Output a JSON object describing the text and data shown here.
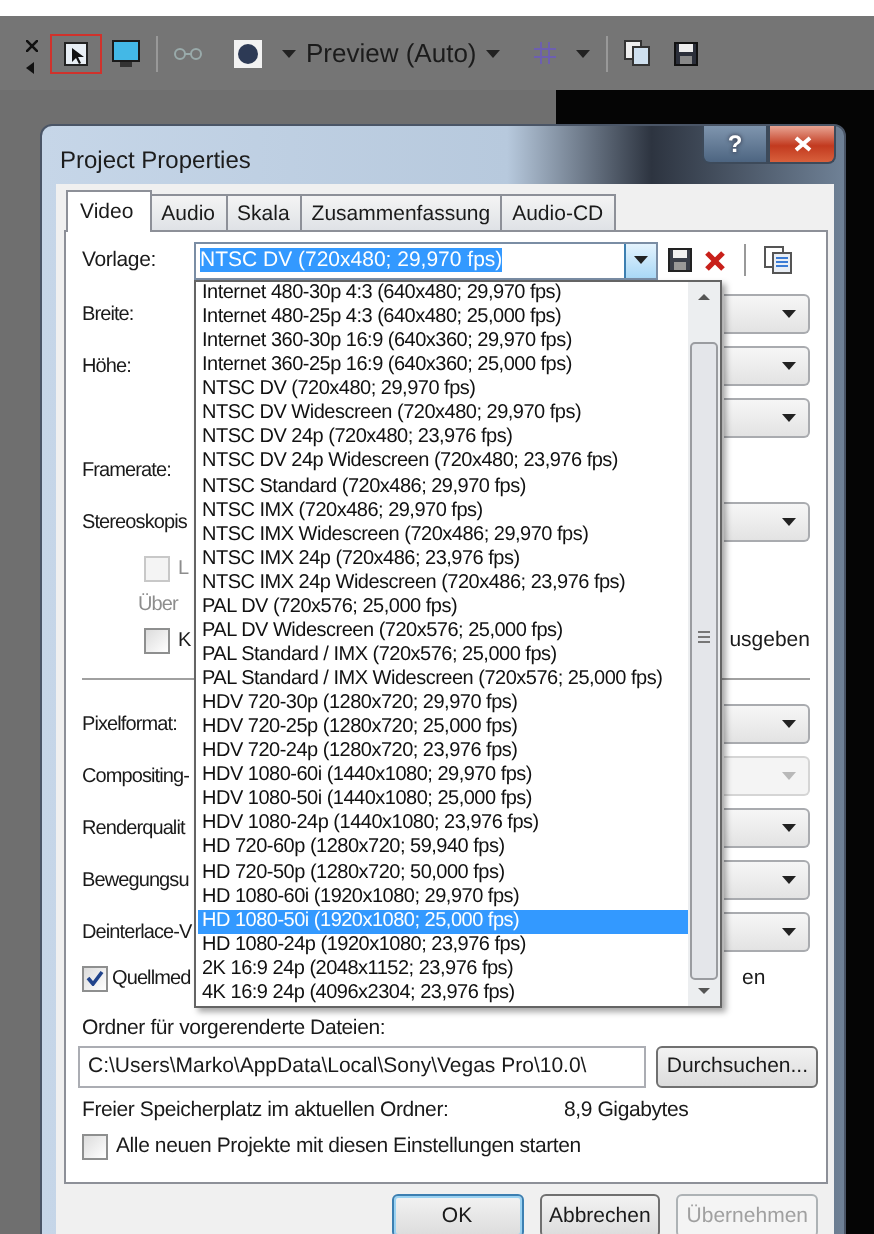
{
  "toolbar": {
    "preview_label": "Preview (Auto)"
  },
  "dialog": {
    "title": "Project Properties",
    "help_button": "?",
    "tabs": [
      {
        "label": "Video",
        "selected": true
      },
      {
        "label": "Audio",
        "selected": false
      },
      {
        "label": "Skala",
        "selected": false
      },
      {
        "label": "Zusammenfassung",
        "selected": false
      },
      {
        "label": "Audio-CD",
        "selected": false
      }
    ],
    "template": {
      "label": "Vorlage:",
      "value": "NTSC DV (720x480; 29,970 fps)"
    },
    "template_list": [
      {
        "label": "Internet 480-30p 4:3 (640x480; 29,970 fps)",
        "selected": false
      },
      {
        "label": "Internet 480-25p 4:3 (640x480; 25,000 fps)",
        "selected": false
      },
      {
        "label": "Internet 360-30p 16:9 (640x360; 29,970 fps)",
        "selected": false
      },
      {
        "label": "Internet 360-25p 16:9 (640x360; 25,000 fps)",
        "selected": false
      },
      {
        "label": "NTSC DV (720x480; 29,970 fps)",
        "selected": false
      },
      {
        "label": "NTSC DV Widescreen (720x480; 29,970 fps)",
        "selected": false
      },
      {
        "label": "NTSC DV 24p (720x480; 23,976 fps)",
        "selected": false
      },
      {
        "label": "NTSC DV 24p Widescreen (720x480; 23,976 fps)",
        "selected": false
      },
      {
        "label": "NTSC Standard (720x486; 29,970 fps)",
        "selected": false
      },
      {
        "label": "NTSC IMX (720x486; 29,970 fps)",
        "selected": false
      },
      {
        "label": "NTSC IMX Widescreen (720x486; 29,970 fps)",
        "selected": false
      },
      {
        "label": "NTSC IMX 24p (720x486; 23,976 fps)",
        "selected": false
      },
      {
        "label": "NTSC IMX 24p Widescreen (720x486; 23,976 fps)",
        "selected": false
      },
      {
        "label": "PAL DV (720x576; 25,000 fps)",
        "selected": false
      },
      {
        "label": "PAL DV Widescreen (720x576; 25,000 fps)",
        "selected": false
      },
      {
        "label": "PAL Standard / IMX (720x576; 25,000 fps)",
        "selected": false
      },
      {
        "label": "PAL Standard / IMX Widescreen (720x576; 25,000 fps)",
        "selected": false
      },
      {
        "label": "HDV 720-30p (1280x720; 29,970 fps)",
        "selected": false
      },
      {
        "label": "HDV 720-25p (1280x720; 25,000 fps)",
        "selected": false
      },
      {
        "label": "HDV 720-24p (1280x720; 23,976 fps)",
        "selected": false
      },
      {
        "label": "HDV 1080-60i (1440x1080; 29,970 fps)",
        "selected": false
      },
      {
        "label": "HDV 1080-50i (1440x1080; 25,000 fps)",
        "selected": false
      },
      {
        "label": "HDV 1080-24p (1440x1080; 23,976 fps)",
        "selected": false
      },
      {
        "label": "HD 720-60p (1280x720; 59,940 fps)",
        "selected": false
      },
      {
        "label": "HD 720-50p (1280x720; 50,000 fps)",
        "selected": false
      },
      {
        "label": "HD 1080-60i (1920x1080; 29,970 fps)",
        "selected": false
      },
      {
        "label": "HD 1080-50i (1920x1080; 25,000 fps)",
        "selected": true
      },
      {
        "label": "HD 1080-24p (1920x1080; 23,976 fps)",
        "selected": false
      },
      {
        "label": "2K 16:9 24p (2048x1152; 23,976 fps)",
        "selected": false
      },
      {
        "label": "4K 16:9 24p (4096x2304; 23,976 fps)",
        "selected": false
      }
    ],
    "rows": [
      {
        "kind": "combo",
        "label": "Breite:",
        "disabled": false
      },
      {
        "kind": "combo",
        "label": "Höhe:",
        "disabled": false
      },
      {
        "kind": "combo",
        "disabled": false
      },
      {
        "kind": "text",
        "label": "Framerate:"
      },
      {
        "kind": "combo",
        "label": "Stereoskopis",
        "disabled": false,
        "children": [
          {
            "kind": "checkbox",
            "label": "L",
            "checked": false,
            "disabled": true
          },
          {
            "kind": "text",
            "label": "Über",
            "disabled": true
          },
          {
            "kind": "checkbox",
            "label": "K",
            "checked": false,
            "disabled": false,
            "label_end": "usgeben"
          }
        ]
      },
      {
        "kind": "rule"
      },
      {
        "kind": "combo",
        "label": "Pixelformat:",
        "disabled": false
      },
      {
        "kind": "combo",
        "label": "Compositing-",
        "disabled": true
      },
      {
        "kind": "combo",
        "label": "Renderqualit",
        "disabled": false
      },
      {
        "kind": "combo",
        "label": "Bewegungsu",
        "disabled": false
      },
      {
        "kind": "combo",
        "label": "Deinterlace-V",
        "disabled": false
      },
      {
        "kind": "checkbox",
        "label": "Quellmed",
        "checked": true,
        "disabled": false,
        "label_end": "en"
      }
    ],
    "prerender_folder": {
      "label": "Ordner für vorgerenderte Dateien:",
      "path": "C:\\Users\\Marko\\AppData\\Local\\Sony\\Vegas Pro\\10.0\\",
      "browse_button": "Durchsuchen..."
    },
    "free_space": {
      "label": "Freier Speicherplatz im aktuellen Ordner:",
      "value": "8,9 Gigabytes"
    },
    "start_with_settings": {
      "label": "Alle neuen Projekte mit diesen Einstellungen starten",
      "checked": false
    },
    "buttons": [
      {
        "label": "OK",
        "disabled": false,
        "default": true
      },
      {
        "label": "Abbrechen",
        "disabled": false,
        "default": false
      },
      {
        "label": "Übernehmen",
        "disabled": true,
        "default": false
      }
    ]
  }
}
